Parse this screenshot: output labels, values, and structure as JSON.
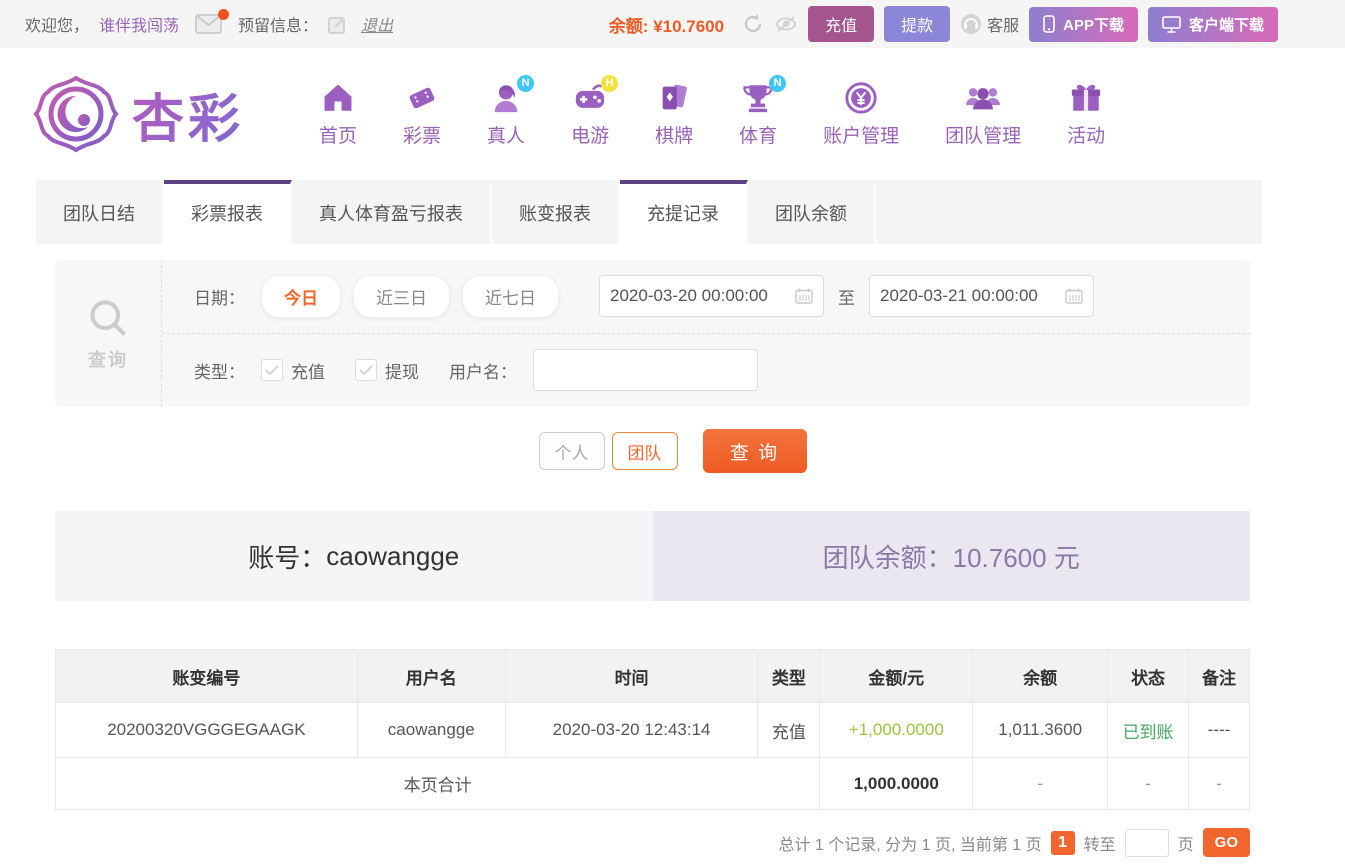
{
  "colors": {
    "accent_orange": "#f2652c",
    "balance_orange": "#f05a23",
    "nav_purple": "#9a63b8",
    "tab_active_purple": "#5d4384",
    "recharge_plum": "#a5548e",
    "withdraw_periwinkle": "#8c86d8",
    "download_gradient_start": "#8d7fd0",
    "download_gradient_end": "#d86ab8",
    "amount_green": "#9bc53d",
    "status_green": "#44a861",
    "summary_right_bg": "#eae7f1"
  },
  "topbar": {
    "welcome_prefix": "欢迎您，",
    "username": "谁伴我闯荡",
    "reserved_label": "预留信息：",
    "logout": "退出",
    "balance_label": "余额:",
    "balance_value": "¥10.7600",
    "recharge": "充值",
    "withdraw": "提款",
    "service": "客服",
    "app_download": "APP下载",
    "client_download": "客户端下载"
  },
  "brand": {
    "name": "杏彩"
  },
  "nav": {
    "items": [
      {
        "label": "首页",
        "badge": ""
      },
      {
        "label": "彩票",
        "badge": ""
      },
      {
        "label": "真人",
        "badge": "N"
      },
      {
        "label": "电游",
        "badge": "H"
      },
      {
        "label": "棋牌",
        "badge": ""
      },
      {
        "label": "体育",
        "badge": "N"
      },
      {
        "label": "账户管理",
        "badge": ""
      },
      {
        "label": "团队管理",
        "badge": ""
      },
      {
        "label": "活动",
        "badge": ""
      }
    ]
  },
  "tabs": {
    "items": [
      {
        "label": "团队日结"
      },
      {
        "label": "彩票报表"
      },
      {
        "label": "真人体育盈亏报表"
      },
      {
        "label": "账变报表"
      },
      {
        "label": "充提记录"
      },
      {
        "label": "团队余额"
      }
    ]
  },
  "filter": {
    "search_label": "查询",
    "date_label": "日期：",
    "quick_ranges": [
      "今日",
      "近三日",
      "近七日"
    ],
    "date_from": "2020-03-20 00:00:00",
    "to_label": "至",
    "date_to": "2020-03-21 00:00:00",
    "type_label": "类型：",
    "type_options": [
      "充值",
      "提现"
    ],
    "username_label": "用户名：",
    "username_value": ""
  },
  "actions": {
    "personal": "个人",
    "team": "团队",
    "search": "查 询"
  },
  "summary": {
    "account_label": "账号：",
    "account_value": "caowangge",
    "team_balance_label": "团队余额：",
    "team_balance_value": "10.7600 元"
  },
  "table": {
    "headers": [
      "账变编号",
      "用户名",
      "时间",
      "类型",
      "金额/元",
      "余额",
      "状态",
      "备注"
    ],
    "rows": [
      {
        "id": "20200320VGGGEGAAGK",
        "user": "caowangge",
        "time": "2020-03-20 12:43:14",
        "type": "充值",
        "amount": "+1,000.0000",
        "balance": "1,011.3600",
        "status": "已到账",
        "remark": "----"
      }
    ],
    "totals": {
      "label": "本页合计",
      "amount": "1,000.0000",
      "balance": "-",
      "status": "-",
      "remark": "-"
    }
  },
  "pagination": {
    "summary": "总计 1 个记录, 分为 1 页, 当前第 1 页",
    "current_page": "1",
    "goto_label": "转至",
    "page_label": "页",
    "go": "GO"
  }
}
